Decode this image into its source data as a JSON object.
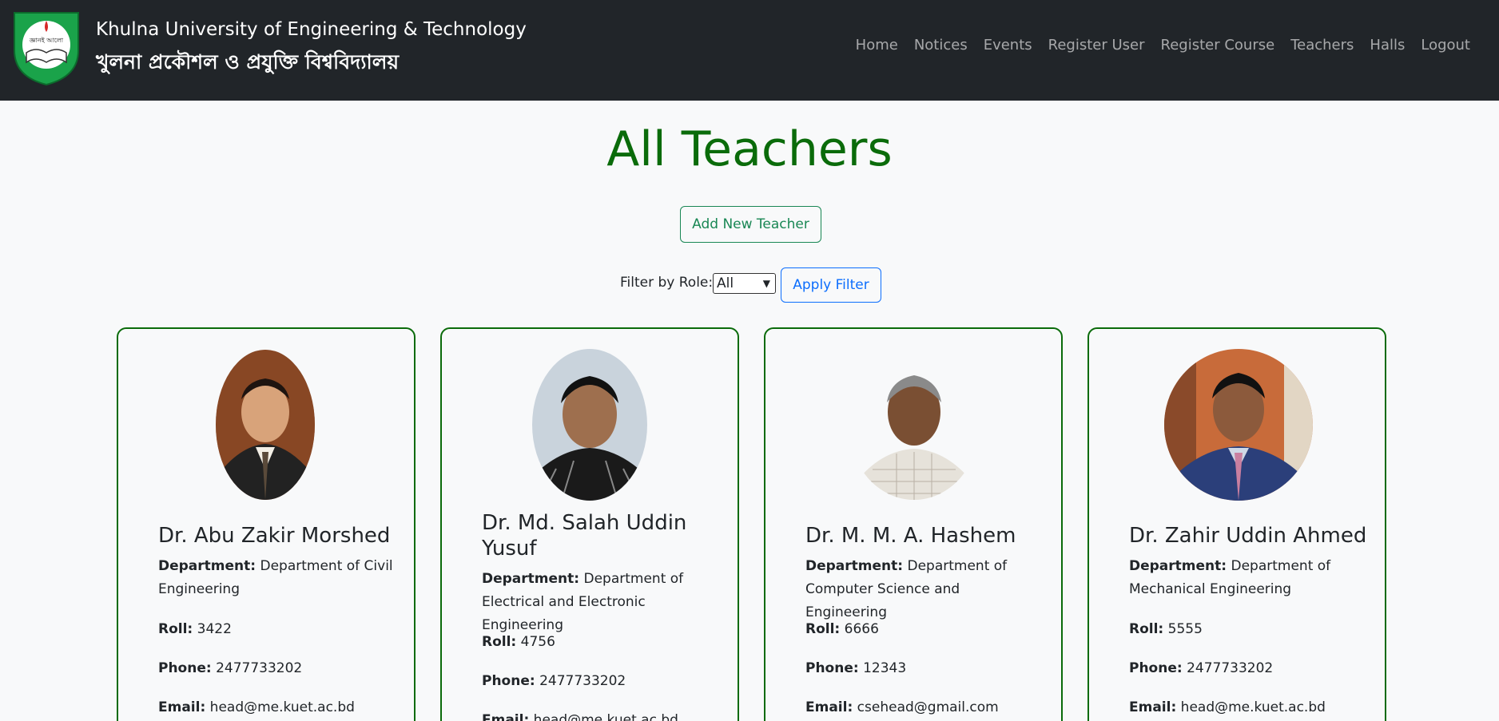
{
  "header": {
    "title_en": "Khulna University of Engineering & Technology",
    "title_bn": "খুলনা প্রকৌশল ও প্রযুক্তি বিশ্ববিদ্যালয়",
    "logo_text": "জ্ঞানই আলো",
    "nav": [
      "Home",
      "Notices",
      "Events",
      "Register User",
      "Register Course",
      "Teachers",
      "Halls",
      "Logout"
    ]
  },
  "page": {
    "title": "All Teachers",
    "add_button": "Add New Teacher",
    "filter_label": "Filter by Role:",
    "filter_value": "All",
    "apply_button": "Apply Filter"
  },
  "labels": {
    "department": "Department:",
    "roll": "Roll:",
    "phone": "Phone:",
    "email": "Email:"
  },
  "teachers": [
    {
      "name": "Dr. Abu Zakir Morshed",
      "department": "Department of Civil Engineering",
      "roll": "3422",
      "phone": "2477733202",
      "email": "head@me.kuet.ac.bd"
    },
    {
      "name": "Dr. Md. Salah Uddin Yusuf",
      "department": "Department of Electrical and Electronic Engineering",
      "roll": "4756",
      "phone": "2477733202",
      "email": "head@me.kuet.ac.bd"
    },
    {
      "name": "Dr. M. M. A. Hashem",
      "department": "Department of Computer Science and Engineering",
      "roll": "6666",
      "phone": "12343",
      "email": "csehead@gmail.com"
    },
    {
      "name": "Dr. Zahir Uddin Ahmed",
      "department": "Department of Mechanical Engineering",
      "roll": "5555",
      "phone": "2477733202",
      "email": "head@me.kuet.ac.bd"
    }
  ],
  "colors": {
    "navbar": "#212529",
    "title_green": "#0a6b0a",
    "card_border": "#0a6b0a",
    "add_button": "#198754",
    "apply_button": "#0d6efd"
  }
}
